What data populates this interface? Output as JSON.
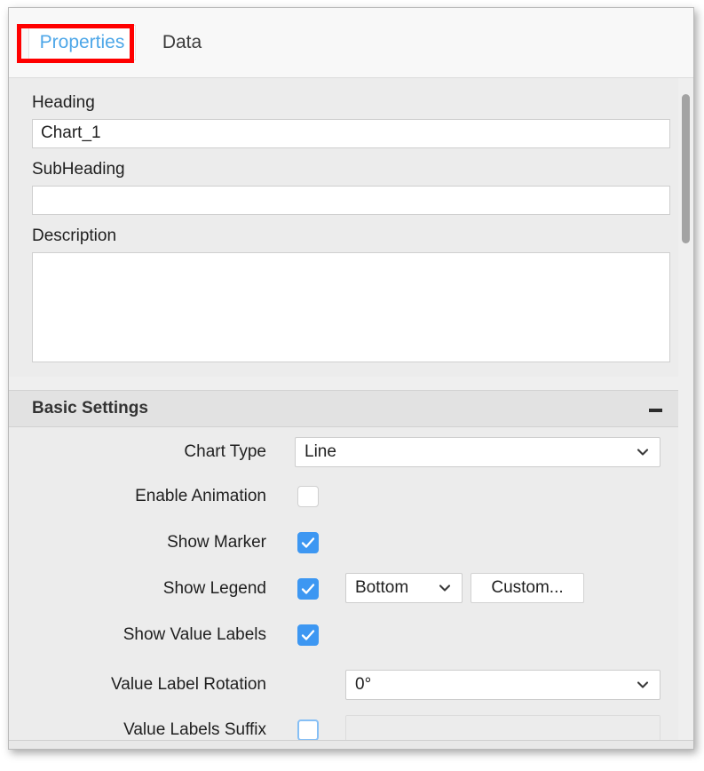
{
  "window": {
    "tabs": [
      {
        "label": "Properties",
        "selected": true
      },
      {
        "label": "Data",
        "selected": false
      }
    ],
    "annotation_color": "#ff0000",
    "selected_tab_text_color": "#4ea7e8"
  },
  "general": {
    "heading_label": "Heading",
    "heading_value": "Chart_1",
    "heading_placeholder": "",
    "subheading_label": "SubHeading",
    "subheading_value": "",
    "subheading_placeholder": "",
    "description_label": "Description",
    "description_value": "",
    "description_placeholder": ""
  },
  "basic_settings": {
    "title": "Basic Settings",
    "collapse_icon": "minus-icon",
    "rows": {
      "chart_type": {
        "label": "Chart Type",
        "value": "Line",
        "icon": "chevron-down-icon"
      },
      "enable_animation": {
        "label": "Enable Animation",
        "checked": false
      },
      "show_marker": {
        "label": "Show Marker",
        "checked": true
      },
      "show_legend": {
        "label": "Show Legend",
        "checked": true,
        "position_value": "Bottom",
        "custom_button": "Custom..."
      },
      "show_value_labels": {
        "label": "Show Value Labels",
        "checked": true
      },
      "value_label_rotation": {
        "label": "Value Label Rotation",
        "value": "0°",
        "icon": "chevron-down-icon"
      },
      "value_labels_suffix": {
        "label": "Value Labels Suffix",
        "checked": false,
        "value": "",
        "placeholder": ""
      }
    }
  },
  "scrollbar": {
    "orientation": "vertical",
    "thumb_color": "#a3a3a3"
  },
  "colors": {
    "checkbox_on": "#3d97f2",
    "panel_bg": "#ececec",
    "section_header_bg": "#e2e2e2"
  }
}
